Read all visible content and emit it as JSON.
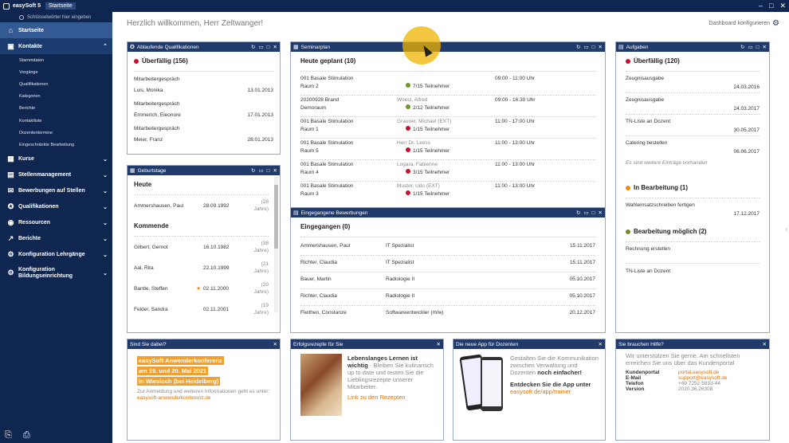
{
  "topbar": {
    "app": "easySoft 5",
    "tab": "Startseite"
  },
  "sidebar": {
    "search_placeholder": "Schlüsselwörter hier eingeben",
    "home": "Startseite",
    "contacts": "Kontakte",
    "contact_sub": [
      "Stammdaten",
      "Vorgänge",
      "Qualifikationen",
      "Kategorien",
      "Berichte",
      "Kontaktliste",
      "Dozententermine",
      "Eingeschränkte Bearbeitung"
    ],
    "modules": [
      "Kurse",
      "Stellenmanagement",
      "Bewerbungen auf Stellen",
      "Qualifikationen",
      "Ressourcen",
      "Berichte",
      "Konfiguration Lehrgänge"
    ],
    "bildung": [
      "Konfiguration",
      "Bildungseinrichtung"
    ]
  },
  "main": {
    "welcome": "Herzlich willkommen, Herr Zeltwanger!",
    "config": "Dashboard konfigurieren"
  },
  "qual": {
    "title": "Ablaufende Qualifikationen",
    "section": "Überfällig (156)",
    "items": [
      {
        "type": "Mitarbeitergespräch",
        "name": "Luis, Monika",
        "date": "13.01.2013"
      },
      {
        "type": "Mitarbeitergespräch",
        "name": "Emmerich, Eleonore",
        "date": "17.01.2013"
      },
      {
        "type": "Mitarbeitergespräch",
        "name": "Meier, Franz",
        "date": "28.01.2013"
      }
    ]
  },
  "birthdays": {
    "title": "Geburtstage",
    "today": "Heute",
    "coming": "Kommende",
    "today_items": [
      {
        "name": "Ammershausen, Paul",
        "date": "28.09.1992",
        "age": "(28",
        "years": "Jahre)"
      }
    ],
    "items": [
      {
        "name": "Gilbert, Gernot",
        "date": "16.10.1982",
        "age": "(38",
        "years": "Jahre)"
      },
      {
        "name": "Aal, Rita",
        "date": "22.10.1999",
        "age": "(21",
        "years": "Jahre)"
      },
      {
        "name": "Bantle, Steffen",
        "date": "02.11.2000",
        "age": "(20",
        "years": "Jahre)"
      },
      {
        "name": "Felder, Sandra",
        "date": "02.11.2001",
        "age": "(19",
        "years": "Jahre)"
      }
    ]
  },
  "seminar": {
    "title": "Seminarplan",
    "section": "Heute geplant (10)",
    "items": [
      {
        "course": "001 Basale Stimulation",
        "room": "Raum 2",
        "trainer": "",
        "part": "7/15 Teilnehmer",
        "status": "green",
        "time": "09:00 - 11:00 Uhr"
      },
      {
        "course": "20200928 Brand",
        "room": "Demoraum",
        "trainer": "Woest, Alfred",
        "part": "2/12 Teilnehmer",
        "status": "green",
        "time": "09:00 - 16:30 Uhr"
      },
      {
        "course": "001 Basale Stimulation",
        "room": "Raum 1",
        "trainer": "Grauner, Michael (EXT)",
        "part": "1/15 Teilnehmer",
        "status": "red",
        "time": "11:00 - 17:00 Uhr"
      },
      {
        "course": "001 Basale Stimulation",
        "room": "Raum 5",
        "trainer": "Herr Dr. Leess",
        "part": "1/15 Teilnehmer",
        "status": "red",
        "time": "11:00 - 13:00 Uhr"
      },
      {
        "course": "001 Basale Stimulation",
        "room": "Raum 4",
        "trainer": "Logara, Fabienne",
        "part": "3/15 Teilnehmer",
        "status": "red",
        "time": "11:00 - 13:00 Uhr"
      },
      {
        "course": "001 Basale Stimulation",
        "room": "Raum 3",
        "trainer": "Muster, Udo (EXT)",
        "part": "1/15 Teilnehmer",
        "status": "red",
        "time": "11:00 - 13:00 Uhr"
      }
    ]
  },
  "apps": {
    "title": "Eingegangene Bewerbungen",
    "section": "Eingegangen (0)",
    "items": [
      {
        "name": "Ammershausen, Paul",
        "job": "IT Spezialist",
        "date": "15.11.2017"
      },
      {
        "name": "Richter, Claudia",
        "job": "IT Spezialist",
        "date": "15.11.2017"
      },
      {
        "name": "Bauer, Martin",
        "job": "Radiologie II",
        "date": "05.10.2017"
      },
      {
        "name": "Richter, Claudia",
        "job": "Radiologie II",
        "date": "05.10.2017"
      },
      {
        "name": "Fleithen, Constanze",
        "job": "Softwareentwickler (m/w)",
        "date": "20.12.2017"
      }
    ]
  },
  "tasks": {
    "title": "Aufgaben",
    "overdue": "Überfällig (120)",
    "overdue_items": [
      {
        "name": "Zeugnisausgabe",
        "date": "24.03.2016"
      },
      {
        "name": "Zeugnisausgabe",
        "date": "24.03.2017"
      },
      {
        "name": "TN-Liste an Dozent",
        "date": "30.05.2017"
      },
      {
        "name": "Catering bestellen",
        "date": "06.06.2017"
      }
    ],
    "more": "Es sind weitere Einträge vorhanden",
    "inprog": "In Bearbeitung (1)",
    "inprog_items": [
      {
        "name": "Wahleinsatzschreiben fertigen",
        "date": "17.12.2017"
      }
    ],
    "possible": "Bearbeitung möglich (2)",
    "possible_items": [
      "Rechnung erstellen",
      "TN-Liste an Dozent"
    ]
  },
  "promo": {
    "title": "Sind Sie dabei?",
    "h1": "easySoft Anwenderkonferenz",
    "h2": "am 19. und 20. Mai 2021",
    "h3": "in Wiesloch (bei Heidelberg)",
    "text": "Zur Anmeldung und weiteren Informationen geht es unter:",
    "link": "easysoft-anwenderkonferenz.de"
  },
  "recipes": {
    "title": "Erfolgsrezepte für Sie",
    "bold": "Lebenslanges Lernen ist wichtig",
    "text": "- Bleiben Sie kulinarisch up to date und testen Sie die Lieblingsrezepte unserer Mitarbeiter.",
    "link": "Link zu den Rezepten"
  },
  "app": {
    "title": "Die neue App für Dozenten",
    "text": "Gestalten Sie die Kommunikation zwischen Verwaltung und Dozenten",
    "bold": "noch einfacher!",
    "cta": "Entdecken Sie die App unter",
    "link": "easysoft.de/app/trainer"
  },
  "help": {
    "title": "Sie brauchen Hilfe?",
    "text": "Wir unterstützen Sie gerne. Am schnellsten erreichen Sie uns über das Kundenportal",
    "rows": [
      {
        "k": "Kundenportal",
        "v": "portal.easysoft.de",
        "link": true
      },
      {
        "k": "E-Mail",
        "v": "support@easysoft.de",
        "link": true
      },
      {
        "k": "Telefon",
        "v": "+49 7252 5833-44",
        "link": false
      },
      {
        "k": "Version",
        "v": "2020.36.26308",
        "link": false
      }
    ]
  },
  "colors": {
    "nav": "#0f2650",
    "header": "#1f3a6b",
    "accent": "#f08c00",
    "overdue": "#c8102e",
    "ok": "#6a9a2a"
  }
}
